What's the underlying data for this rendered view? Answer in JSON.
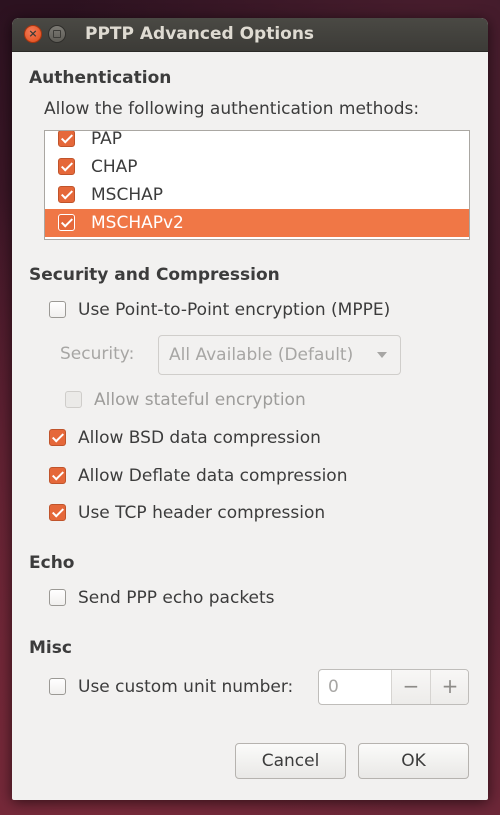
{
  "window": {
    "title": "PPTP Advanced Options"
  },
  "authentication": {
    "heading": "Authentication",
    "prompt": "Allow the following authentication methods:",
    "methods": [
      {
        "label": "PAP",
        "checked": true,
        "selected": false
      },
      {
        "label": "CHAP",
        "checked": true,
        "selected": false
      },
      {
        "label": "MSCHAP",
        "checked": true,
        "selected": false
      },
      {
        "label": "MSCHAPv2",
        "checked": true,
        "selected": true
      }
    ]
  },
  "security": {
    "heading": "Security and Compression",
    "mppe_label": "Use Point-to-Point encryption (MPPE)",
    "mppe_checked": false,
    "security_label": "Security:",
    "security_value": "All Available (Default)",
    "stateful_label": "Allow stateful encryption",
    "stateful_checked": false,
    "bsd_label": "Allow BSD data compression",
    "bsd_checked": true,
    "deflate_label": "Allow Deflate data compression",
    "deflate_checked": true,
    "tcp_label": "Use TCP header compression",
    "tcp_checked": true
  },
  "echo": {
    "heading": "Echo",
    "send_label": "Send PPP echo packets",
    "send_checked": false
  },
  "misc": {
    "heading": "Misc",
    "unit_label": "Use custom unit number:",
    "unit_checked": false,
    "unit_value": "0",
    "minus": "−",
    "plus": "+"
  },
  "buttons": {
    "cancel": "Cancel",
    "ok": "OK"
  },
  "colors": {
    "accent": "#f07746",
    "checkbox_checked": "#e5683a",
    "titlebar": "#3c3b37",
    "dialog_bg": "#f2f1f0"
  }
}
